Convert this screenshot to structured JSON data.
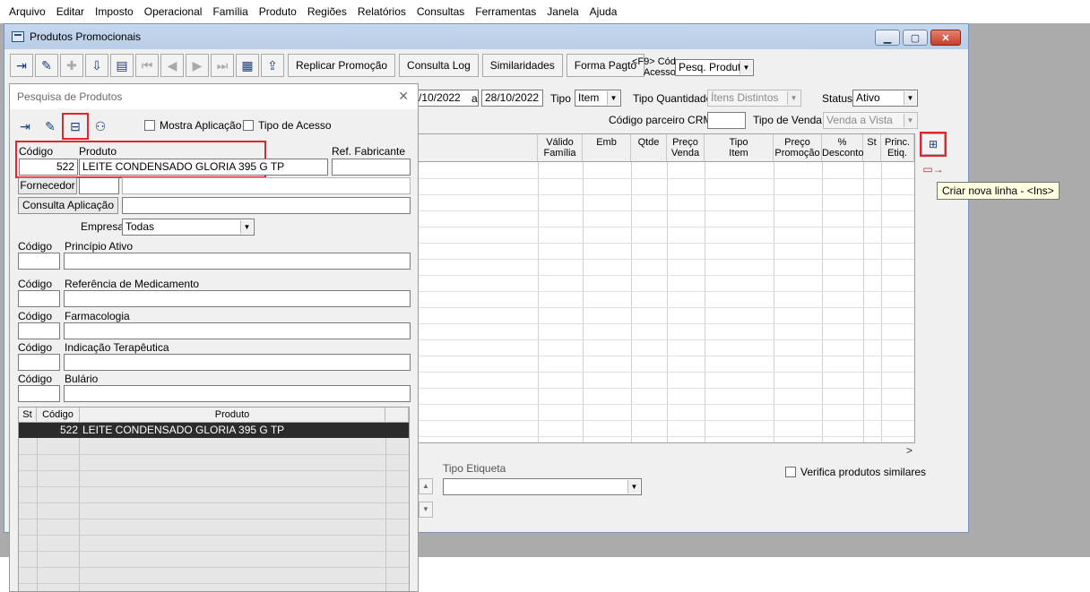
{
  "menu": [
    "Arquivo",
    "Editar",
    "Imposto",
    "Operacional",
    "Família",
    "Produto",
    "Regiões",
    "Relatórios",
    "Consultas",
    "Ferramentas",
    "Janela",
    "Ajuda"
  ],
  "window": {
    "title": "Produtos Promocionais",
    "buttons": {
      "minimize": "▁",
      "maximize": "▢",
      "close": "✕"
    }
  },
  "toolbar": {
    "text_buttons": [
      "Replicar Promoção",
      "Consulta Log",
      "Similaridades",
      "Forma Pagto"
    ],
    "f9_line1": "<F9> Cód",
    "f9_line2": "Acesso",
    "search_select": "Pesq. Produtc"
  },
  "filters": {
    "date_from": "/10/2022",
    "date_to_label": "a",
    "date_to": "28/10/2022",
    "tipo_label": "Tipo",
    "tipo_value": "Item",
    "tipo_qtd_label": "Tipo Quantidade",
    "tipo_qtd_value": "Ítens Distintos",
    "status_label": "Status",
    "status_value": "Ativo",
    "crm_label": "Código parceiro CRM",
    "crm_value": "",
    "tipo_venda_label": "Tipo de Venda",
    "tipo_venda_value": "Venda a Vista"
  },
  "grid": {
    "columns": [
      {
        "l1": "Válido",
        "l2": "Família"
      },
      {
        "l1": "Emb",
        "l2": ""
      },
      {
        "l1": "Qtde",
        "l2": ""
      },
      {
        "l1": "Preço",
        "l2": "Venda"
      },
      {
        "l1": "Tipo",
        "l2": "Item"
      },
      {
        "l1": "Preço",
        "l2": "Promoção"
      },
      {
        "l1": "%",
        "l2": "Desconto"
      },
      {
        "l1": "St",
        "l2": ""
      },
      {
        "l1": "Princ.",
        "l2": "Etiq."
      }
    ]
  },
  "tooltip": "Criar nova linha - <Ins>",
  "bottom": {
    "tipo_etiqueta_label": "Tipo Etiqueta",
    "tipo_etiqueta_value": "",
    "verifica_label": "Verifica produtos similares"
  },
  "dialog": {
    "title": "Pesquisa de Produtos",
    "close": "✕",
    "mostra_aplicacao": "Mostra Aplicação",
    "tipo_acesso": "Tipo de Acesso",
    "codigo_label": "Código",
    "produto_label": "Produto",
    "ref_label": "Ref. Fabricante",
    "codigo_value": "522",
    "produto_value": "LEITE CONDENSADO GLORIA 395 G TP",
    "ref_value": "",
    "fornecedor_btn": "Fornecedor",
    "consulta_btn": "Consulta Aplicação",
    "empresa_label": "Empresa",
    "empresa_value": "Todas",
    "sections": [
      {
        "code_label": "Código",
        "label": "Princípio Ativo"
      },
      {
        "code_label": "Código",
        "label": "Referência de Medicamento"
      },
      {
        "code_label": "Código",
        "label": "Farmacologia"
      },
      {
        "code_label": "Código",
        "label": "Indicação Terapêutica"
      },
      {
        "code_label": "Código",
        "label": "Bulário"
      }
    ],
    "results": {
      "headers": [
        "St",
        "Código",
        "Produto"
      ],
      "row": {
        "st": "",
        "codigo": "522",
        "produto": "LEITE CONDENSADO GLORIA 395 G TP"
      }
    }
  },
  "icons": [
    "exit-icon",
    "eraser-icon",
    "add-icon",
    "save-icon",
    "print-icon",
    "first-icon",
    "prev-icon",
    "next-icon",
    "last-icon",
    "sheet-icon",
    "export-icon",
    "new-row-icon",
    "delete-row-icon",
    "open-icon",
    "binoculars-icon"
  ]
}
